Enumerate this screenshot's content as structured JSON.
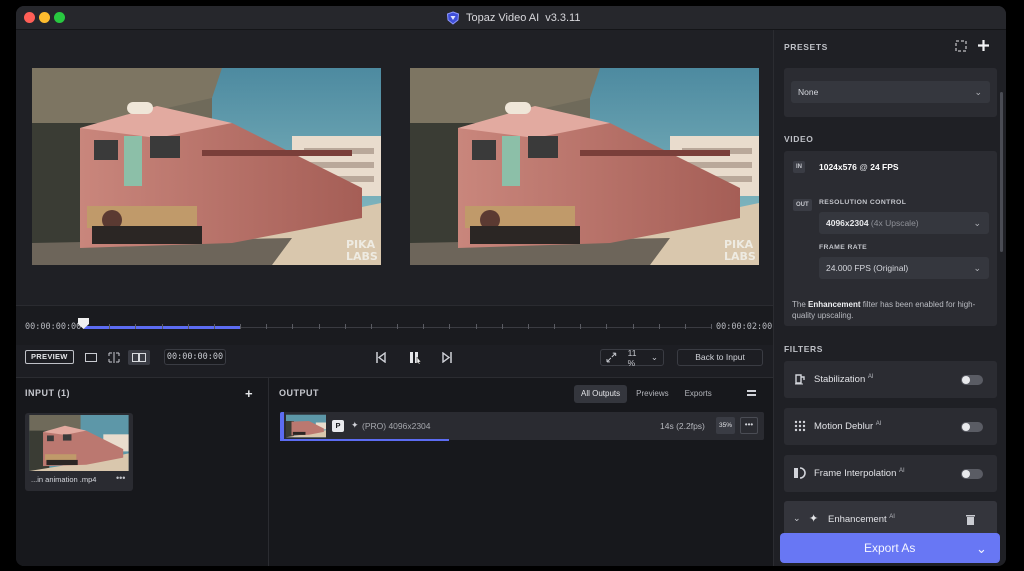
{
  "window": {
    "title": "Topaz Video AI",
    "version": "v3.3.11"
  },
  "timeline": {
    "start_time": "00:00:00:00",
    "end_time": "00:00:02:00",
    "progress_fraction": 0.25
  },
  "controls": {
    "preview_label": "PREVIEW",
    "timecode": "00:00:00:00",
    "zoom": "11 %",
    "back_to_input": "Back to Input"
  },
  "video": {
    "watermark_line1": "PIKA",
    "watermark_line2": "LABS"
  },
  "input": {
    "title": "INPUT (1)",
    "file_name": "...in animation .mp4",
    "more": "•••"
  },
  "output": {
    "title": "OUTPUT",
    "tabs": [
      "All Outputs",
      "Previews",
      "Exports"
    ],
    "active_tab": 0,
    "item": {
      "badge": "P",
      "label": "(PRO)  4096x2304",
      "eta": "14s (2.2fps)",
      "percent": "35%",
      "more": "•••",
      "progress_fraction": 0.35
    }
  },
  "sidebar": {
    "presets_title": "PRESETS",
    "preset_value": "None",
    "video_title": "VIDEO",
    "in_tag": "IN",
    "in_resolution": "1024x576",
    "in_at": "@",
    "in_fps": "24 FPS",
    "out_tag": "OUT",
    "resolution_control_label": "RESOLUTION CONTROL",
    "resolution_value": "4096x2304",
    "resolution_detail": "(4x Upscale)",
    "frame_rate_label": "FRAME RATE",
    "frame_rate_value": "24.000 FPS (Original)",
    "note_prefix": "The",
    "note_bold": "Enhancement",
    "note_suffix": "filter has been enabled for high-quality upscaling.",
    "filters_title": "FILTERS",
    "filters": [
      {
        "name": "Stabilization",
        "ai": "AI",
        "icon": "stabilization-icon"
      },
      {
        "name": "Motion Deblur",
        "ai": "AI",
        "icon": "motion-deblur-icon"
      },
      {
        "name": "Frame Interpolation",
        "ai": "AI",
        "icon": "frame-interpolation-icon"
      },
      {
        "name": "Enhancement",
        "ai": "AI",
        "icon": "enhancement-icon"
      }
    ],
    "export_label": "Export As"
  },
  "colors": {
    "accent": "#6877f4",
    "window_bg": "#1d1e23",
    "sidebar_bg": "#1f2025",
    "card_bg": "#2b2c32"
  }
}
